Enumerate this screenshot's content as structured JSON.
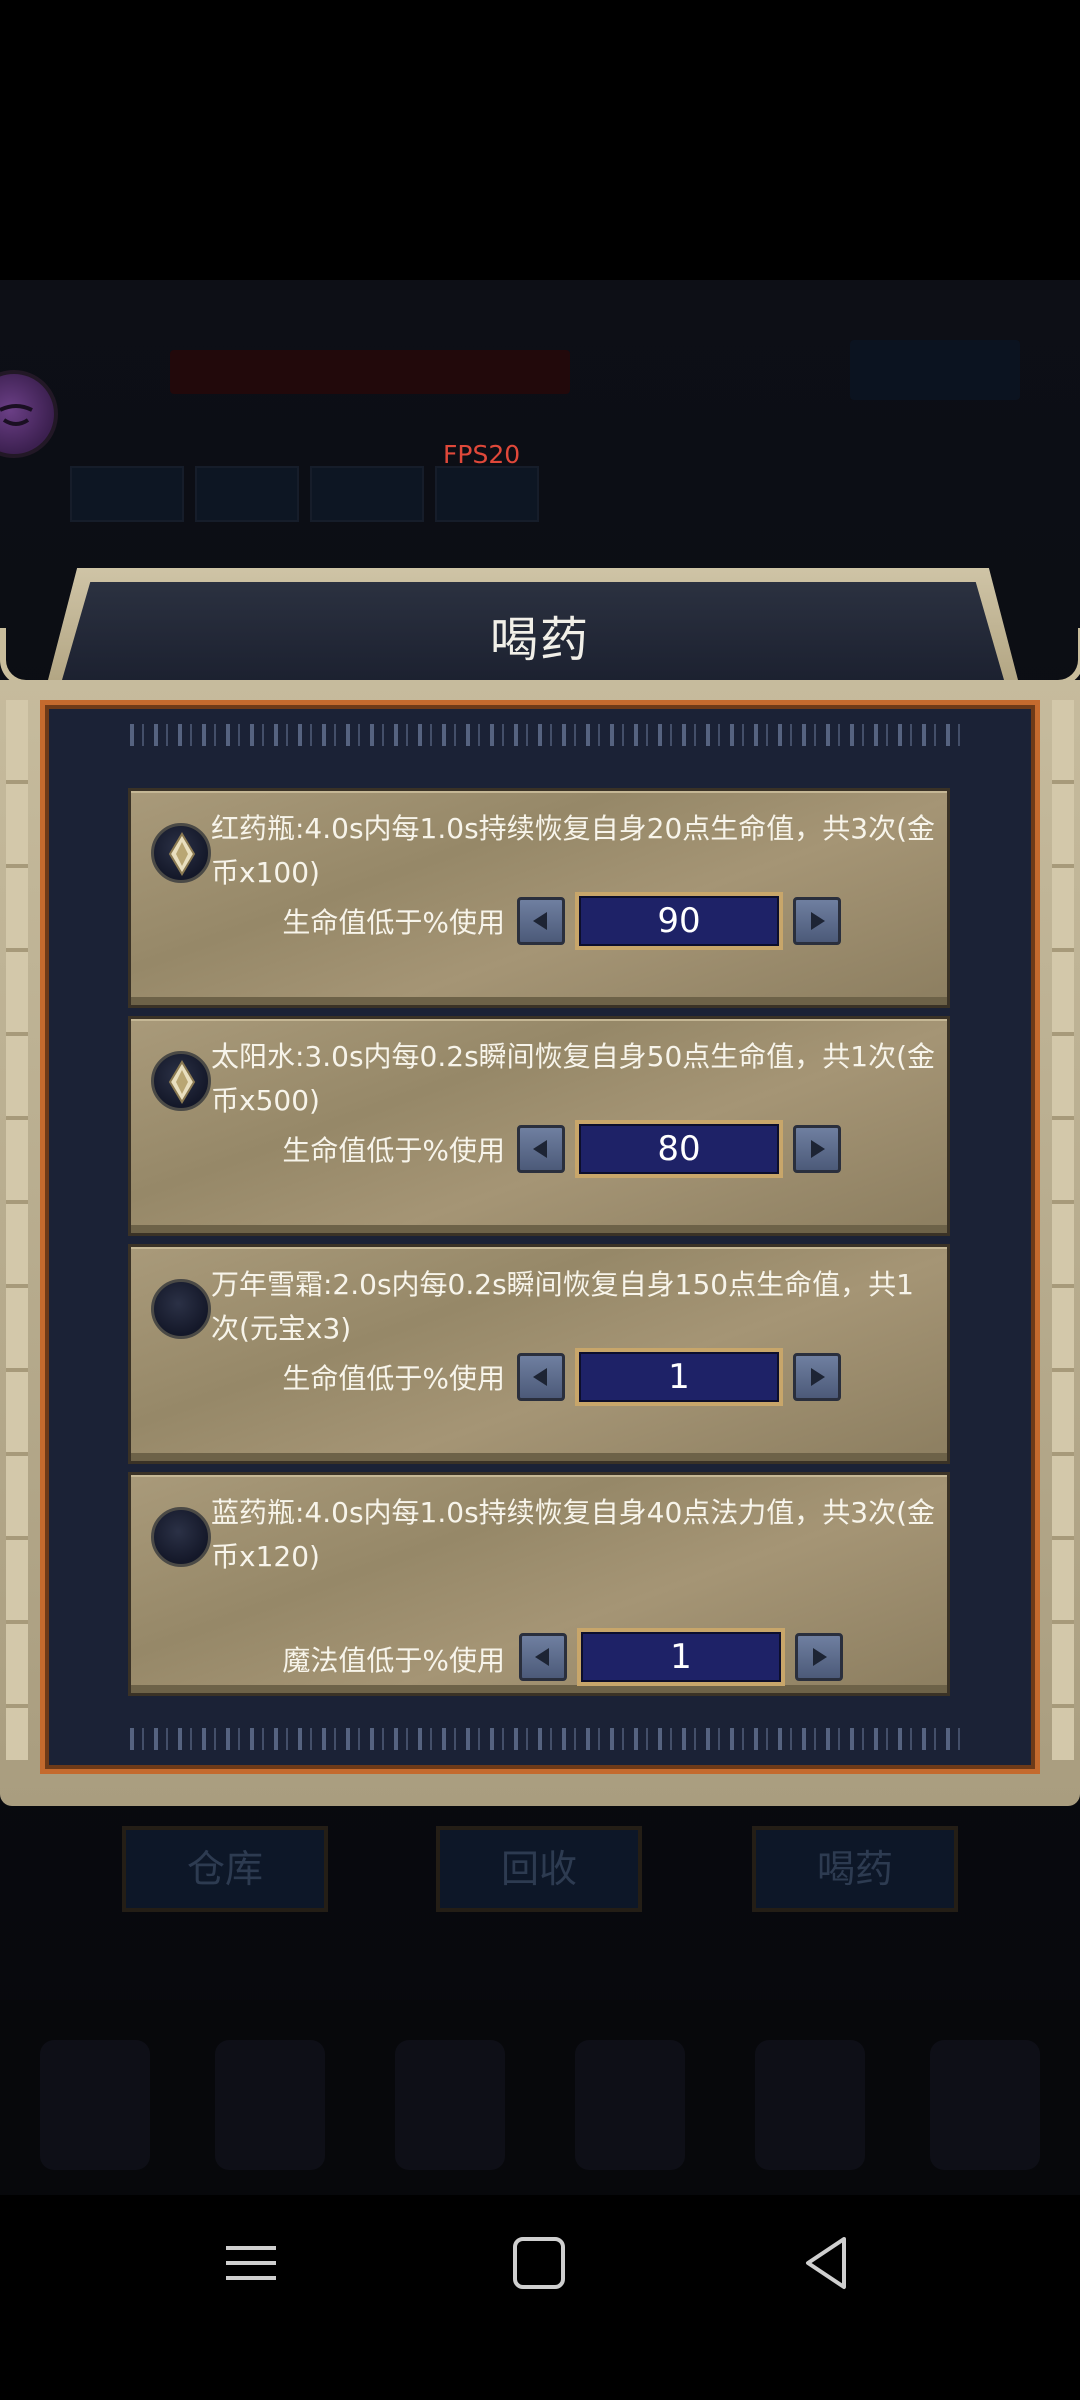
{
  "hud": {
    "fps": "FPS20"
  },
  "dialog": {
    "title": "喝药",
    "potions": [
      {
        "selected": true,
        "description": "红药瓶:4.0s内每1.0s持续恢复自身20点生命值，共3次(金币x100)",
        "threshold_label": "生命值低于%使用",
        "threshold_value": "90"
      },
      {
        "selected": true,
        "description": "太阳水:3.0s内每0.2s瞬间恢复自身50点生命值，共1次(金币x500)",
        "threshold_label": "生命值低于%使用",
        "threshold_value": "80"
      },
      {
        "selected": false,
        "description": "万年雪霜:2.0s内每0.2s瞬间恢复自身150点生命值，共1次(元宝x3)",
        "threshold_label": "生命值低于%使用",
        "threshold_value": "1"
      },
      {
        "selected": false,
        "description": "蓝药瓶:4.0s内每1.0s持续恢复自身40点法力值，共3次(金币x120)",
        "threshold_label": "魔法值低于%使用",
        "threshold_value": "1"
      }
    ]
  },
  "bottom_buttons": {
    "warehouse": "仓库",
    "recycle": "回收",
    "drink": "喝药"
  },
  "system_nav": {
    "icons": [
      "menu-icon",
      "home-icon",
      "back-icon"
    ]
  }
}
